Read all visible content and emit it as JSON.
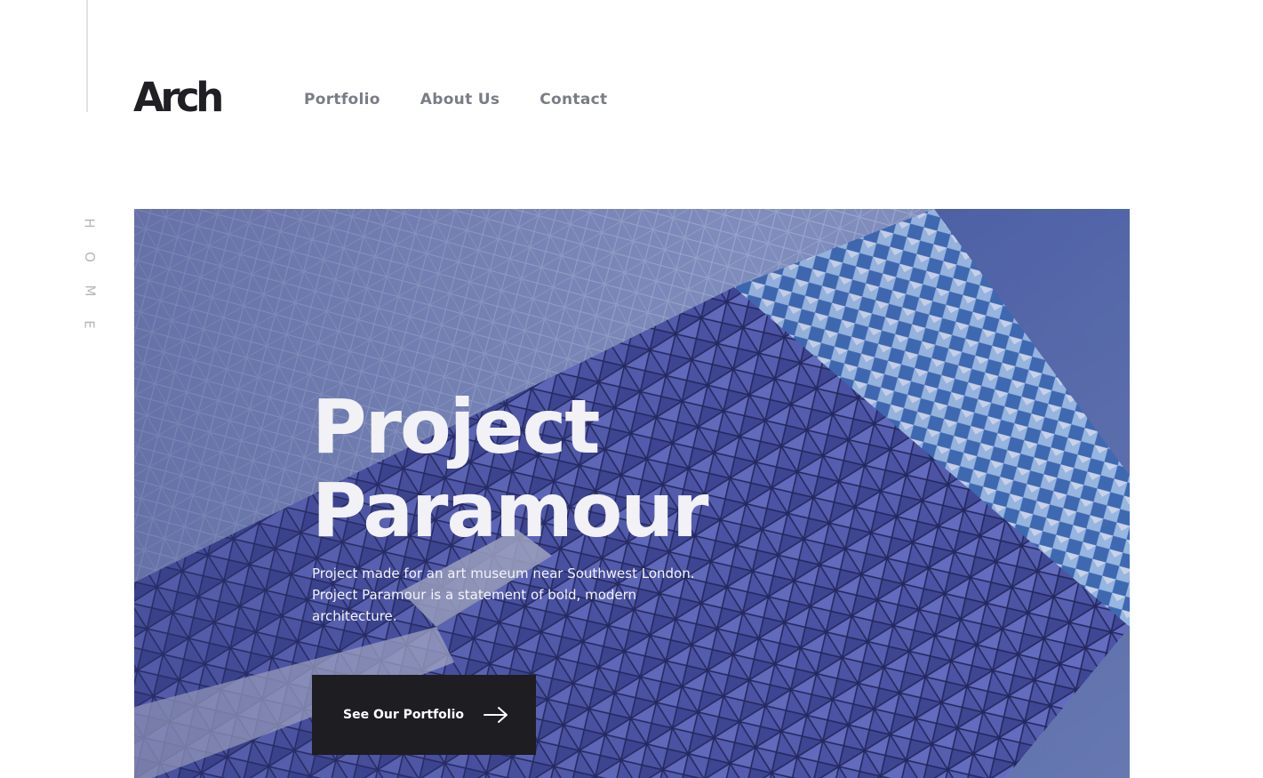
{
  "brand": {
    "logo_text": "Arch"
  },
  "nav": {
    "items": [
      {
        "label": "Portfolio"
      },
      {
        "label": "About Us"
      },
      {
        "label": "Contact"
      }
    ]
  },
  "side_label": {
    "letters": [
      "H",
      "O",
      "M",
      "E"
    ]
  },
  "hero": {
    "title_line1": "Project",
    "title_line2": "Paramour",
    "description": "Project made for an art museum near Southwest London. Project Paramour is a statement of bold, modern architecture.",
    "cta_label": "See Our Portfolio",
    "cta_icon": "arrow-right-icon"
  },
  "colors": {
    "accent_dark": "#1d1d22",
    "nav_text": "#7a7c86",
    "hero_overlay": "#5c6fab"
  }
}
